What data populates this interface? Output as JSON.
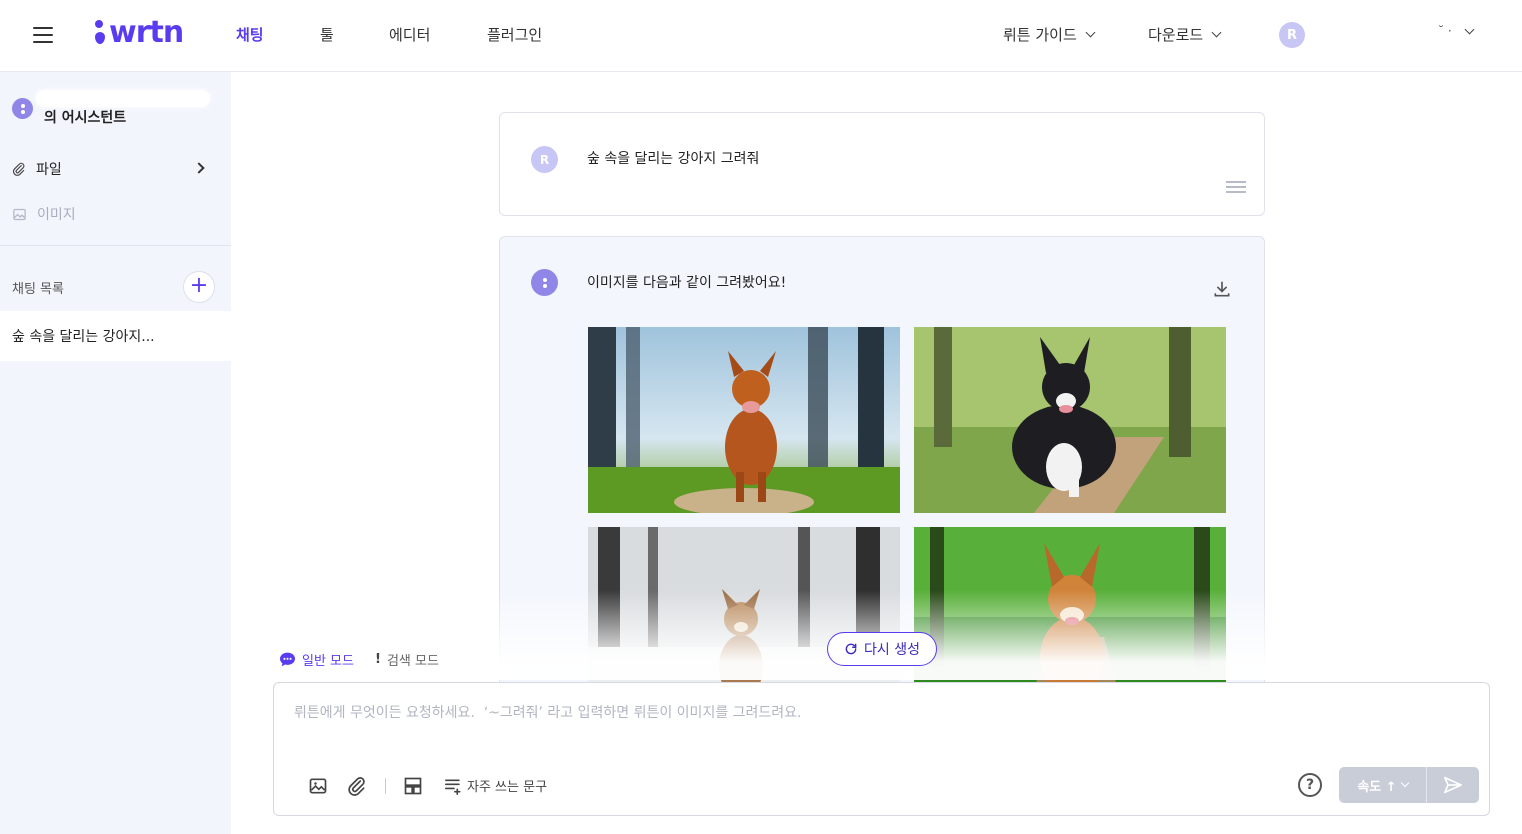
{
  "header": {
    "logo_text": "wrtn",
    "nav": [
      "채팅",
      "툴",
      "에디터",
      "플러그인"
    ],
    "guide_label": "뤼튼 가이드",
    "download_label": "다운로드",
    "avatar_initial": "R",
    "user_name": "˘ ·"
  },
  "sidebar": {
    "assistant_label": "의 어시스턴트",
    "files_label": "파일",
    "images_label": "이미지",
    "chat_list_label": "채팅 목록",
    "add_symbol": "+",
    "chat_items": [
      "숲 속을 달리는 강아지..."
    ]
  },
  "conversation": {
    "user_avatar": "R",
    "user_message": "숲 속을 달리는 강아지 그려줘",
    "ai_message": "이미지를 다음과 같이 그려봤어요!",
    "regenerate_label": "다시 생성"
  },
  "modes": {
    "normal_label": "일반 모드",
    "search_icon_char": "!",
    "search_label": "검색 모드"
  },
  "input": {
    "placeholder": "뤼튼에게 무엇이든 요청하세요.  ‘~그려줘’ 라고 입력하면 뤼튼이 이미지를 그려드려요.",
    "value": "",
    "frequent_phrases_label": "자주 쓰는 문구",
    "help_symbol": "?",
    "speed_label": "속도 ↑"
  },
  "colors": {
    "brand": "#5a3cf0",
    "sidebar_bg": "#f3f5fd",
    "ai_message_bg": "#f3f6fd",
    "avatar_bg": "#c7c6f4",
    "send_disabled": "#c9cdd8"
  }
}
